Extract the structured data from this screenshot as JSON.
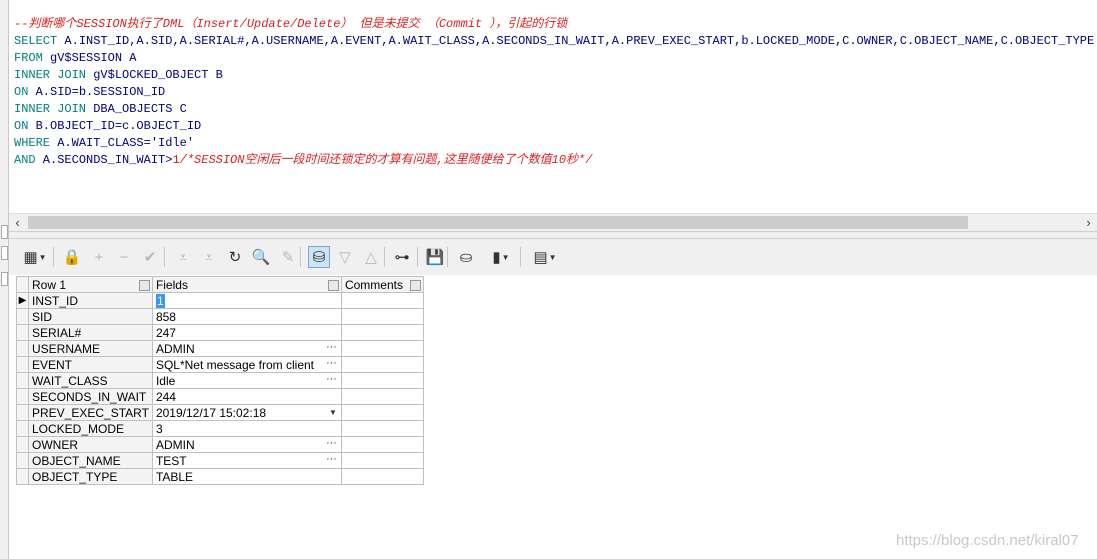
{
  "editor": {
    "lines": [
      [
        {
          "c": "cmt",
          "t": "--判断哪个SESSION执行了DML（Insert/Update/Delete） 但是未提交 （Commit ），引起的行锁"
        }
      ],
      [
        {
          "c": "kw",
          "t": "SELECT"
        },
        {
          "c": "",
          "t": " A.INST_ID,A.SID,A.SERIAL#,A.USERNAME,A.EVENT,A.WAIT_CLASS,A.SECONDS_IN_WAIT,A.PREV_EXEC_START,b.LOCKED_MODE,C.OWNER,C.OBJECT_NAME,C.OBJECT_TYPE"
        }
      ],
      [
        {
          "c": "kw",
          "t": "FROM"
        },
        {
          "c": "",
          "t": " gV$SESSION A"
        }
      ],
      [
        {
          "c": "kw",
          "t": "INNER JOIN"
        },
        {
          "c": "",
          "t": " gV$LOCKED_OBJECT B"
        }
      ],
      [
        {
          "c": "kw",
          "t": "ON"
        },
        {
          "c": "",
          "t": " A.SID=b.SESSION_ID"
        }
      ],
      [
        {
          "c": "kw",
          "t": "INNER JOIN"
        },
        {
          "c": "",
          "t": " DBA_OBJECTS C"
        }
      ],
      [
        {
          "c": "kw",
          "t": "ON"
        },
        {
          "c": "",
          "t": " B.OBJECT_ID=c.OBJECT_ID"
        }
      ],
      [
        {
          "c": "kw",
          "t": "WHERE"
        },
        {
          "c": "",
          "t": " A.WAIT_CLASS="
        },
        {
          "c": "str",
          "t": "'Idle'"
        }
      ],
      [
        {
          "c": "kw",
          "t": "AND"
        },
        {
          "c": "",
          "t": " A.SECONDS_IN_WAIT>"
        },
        {
          "c": "num",
          "t": "1"
        },
        {
          "c": "cmt",
          "t": "/*SESSION空闲后一段时间还锁定的才算有问题,这里随便给了个数值10秒*/"
        }
      ]
    ],
    "scroll_left_icon": "chevron-left-icon",
    "scroll_right_icon": "chevron-right-icon"
  },
  "toolbar": {
    "items": [
      {
        "icon": "single-record-view-icon",
        "glyph": "▦",
        "dropdown": true
      },
      {
        "icon": "lock-icon",
        "glyph": "🔒"
      },
      {
        "icon": "add-record-icon",
        "glyph": "+",
        "disabled": true
      },
      {
        "icon": "delete-record-icon",
        "glyph": "−",
        "disabled": true
      },
      {
        "icon": "post-changes-icon",
        "glyph": "✔",
        "disabled": true
      },
      {
        "icon": "fetch-next-page-icon",
        "glyph": "⩡",
        "disabled": true
      },
      {
        "icon": "fetch-last-page-icon",
        "glyph": "⩡",
        "disabled": true
      },
      {
        "icon": "refresh-icon",
        "glyph": "↻"
      },
      {
        "icon": "find-icon",
        "glyph": "🔍"
      },
      {
        "icon": "clear-record-icon",
        "glyph": "✎",
        "disabled": true
      },
      {
        "icon": "query-by-example-icon",
        "glyph": "⛁",
        "active": true
      },
      {
        "icon": "previous-query-icon",
        "glyph": "▽",
        "disabled": true
      },
      {
        "icon": "next-query-icon",
        "glyph": "△",
        "disabled": true
      },
      {
        "icon": "record-tree-icon",
        "glyph": "⊶"
      },
      {
        "icon": "save-icon",
        "glyph": "💾"
      },
      {
        "icon": "export-icon",
        "glyph": "⛀"
      },
      {
        "icon": "chart-icon",
        "glyph": "▮",
        "dropdown": true
      },
      {
        "icon": "table-grid-icon",
        "glyph": "▤",
        "dropdown": true
      }
    ]
  },
  "grid": {
    "headers": {
      "row": "Row 1",
      "fields": "Fields",
      "comments": "Comments"
    },
    "rows": [
      {
        "field": "INST_ID",
        "value": "1",
        "selected": true,
        "current": true
      },
      {
        "field": "SID",
        "value": "858"
      },
      {
        "field": "SERIAL#",
        "value": "247"
      },
      {
        "field": "USERNAME",
        "value": "ADMIN",
        "ellipsis": true
      },
      {
        "field": "EVENT",
        "value": "SQL*Net message from client",
        "ellipsis": true
      },
      {
        "field": "WAIT_CLASS",
        "value": "Idle",
        "ellipsis": true
      },
      {
        "field": "SECONDS_IN_WAIT",
        "value": "244"
      },
      {
        "field": "PREV_EXEC_START",
        "value": "2019/12/17 15:02:18",
        "dropdown": true
      },
      {
        "field": "LOCKED_MODE",
        "value": "3"
      },
      {
        "field": "OWNER",
        "value": "ADMIN",
        "ellipsis": true
      },
      {
        "field": "OBJECT_NAME",
        "value": "TEST",
        "ellipsis": true
      },
      {
        "field": "OBJECT_TYPE",
        "value": "TABLE"
      }
    ],
    "ellipsis_glyph": "···",
    "current_row_glyph": "▶"
  },
  "watermark": "https://blog.csdn.net/kiral07"
}
